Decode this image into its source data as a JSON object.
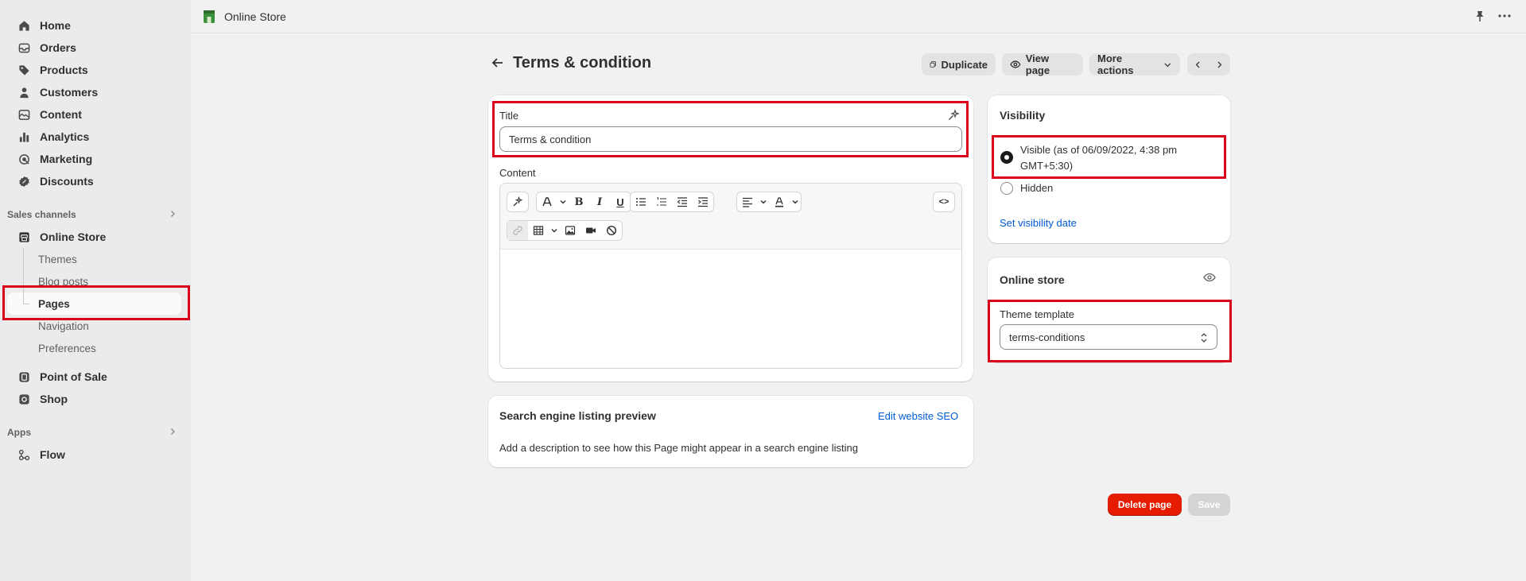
{
  "sidebar": {
    "items": [
      {
        "label": "Home",
        "icon": "home-icon"
      },
      {
        "label": "Orders",
        "icon": "orders-icon"
      },
      {
        "label": "Products",
        "icon": "tag-icon"
      },
      {
        "label": "Customers",
        "icon": "person-icon"
      },
      {
        "label": "Content",
        "icon": "content-icon"
      },
      {
        "label": "Analytics",
        "icon": "analytics-icon"
      },
      {
        "label": "Marketing",
        "icon": "marketing-icon"
      },
      {
        "label": "Discounts",
        "icon": "discount-icon"
      }
    ],
    "sales_channels_label": "Sales channels",
    "online_store_label": "Online Store",
    "online_store_sub": [
      "Themes",
      "Blog posts",
      "Pages",
      "Navigation",
      "Preferences"
    ],
    "point_of_sale_label": "Point of Sale",
    "shop_label": "Shop",
    "apps_label": "Apps",
    "flow_label": "Flow"
  },
  "topbar": {
    "store_name": "Online Store"
  },
  "header": {
    "title": "Terms & condition",
    "duplicate_label": "Duplicate",
    "view_page_label": "View page",
    "more_actions_label": "More actions"
  },
  "main": {
    "title_label": "Title",
    "title_value": "Terms & condition",
    "content_label": "Content",
    "seo_title": "Search engine listing preview",
    "seo_edit_link": "Edit website SEO",
    "seo_description": "Add a description to see how this Page might appear in a search engine listing"
  },
  "visibility": {
    "title": "Visibility",
    "visible_label": "Visible (as of 06/09/2022, 4:38 pm GMT+5:30)",
    "hidden_label": "Hidden",
    "set_date_link": "Set visibility date"
  },
  "online_store_card": {
    "title": "Online store",
    "template_label": "Theme template",
    "template_value": "terms-conditions"
  },
  "footer": {
    "delete_label": "Delete page",
    "save_label": "Save"
  },
  "colors": {
    "highlight": "#d9001b",
    "danger": "#e51c00",
    "link": "#005bd3"
  }
}
